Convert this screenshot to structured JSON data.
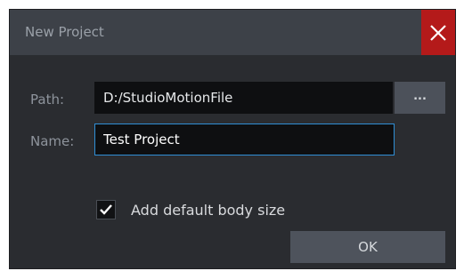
{
  "window": {
    "title": "New Project",
    "close_icon": "close-icon"
  },
  "form": {
    "path_label": "Path:",
    "path_value": "D:/StudioMotionFile",
    "browse_label": "...",
    "name_label": "Name:",
    "name_value": "Test Project",
    "checkbox_checked": true,
    "checkbox_label": "Add default body size"
  },
  "actions": {
    "ok_label": "OK"
  },
  "colors": {
    "background": "#2a2c30",
    "titlebar": "#3d4148",
    "close_button": "#b41a1a",
    "focus_border": "#2f8fd6",
    "checkmark": "#ffffff"
  }
}
